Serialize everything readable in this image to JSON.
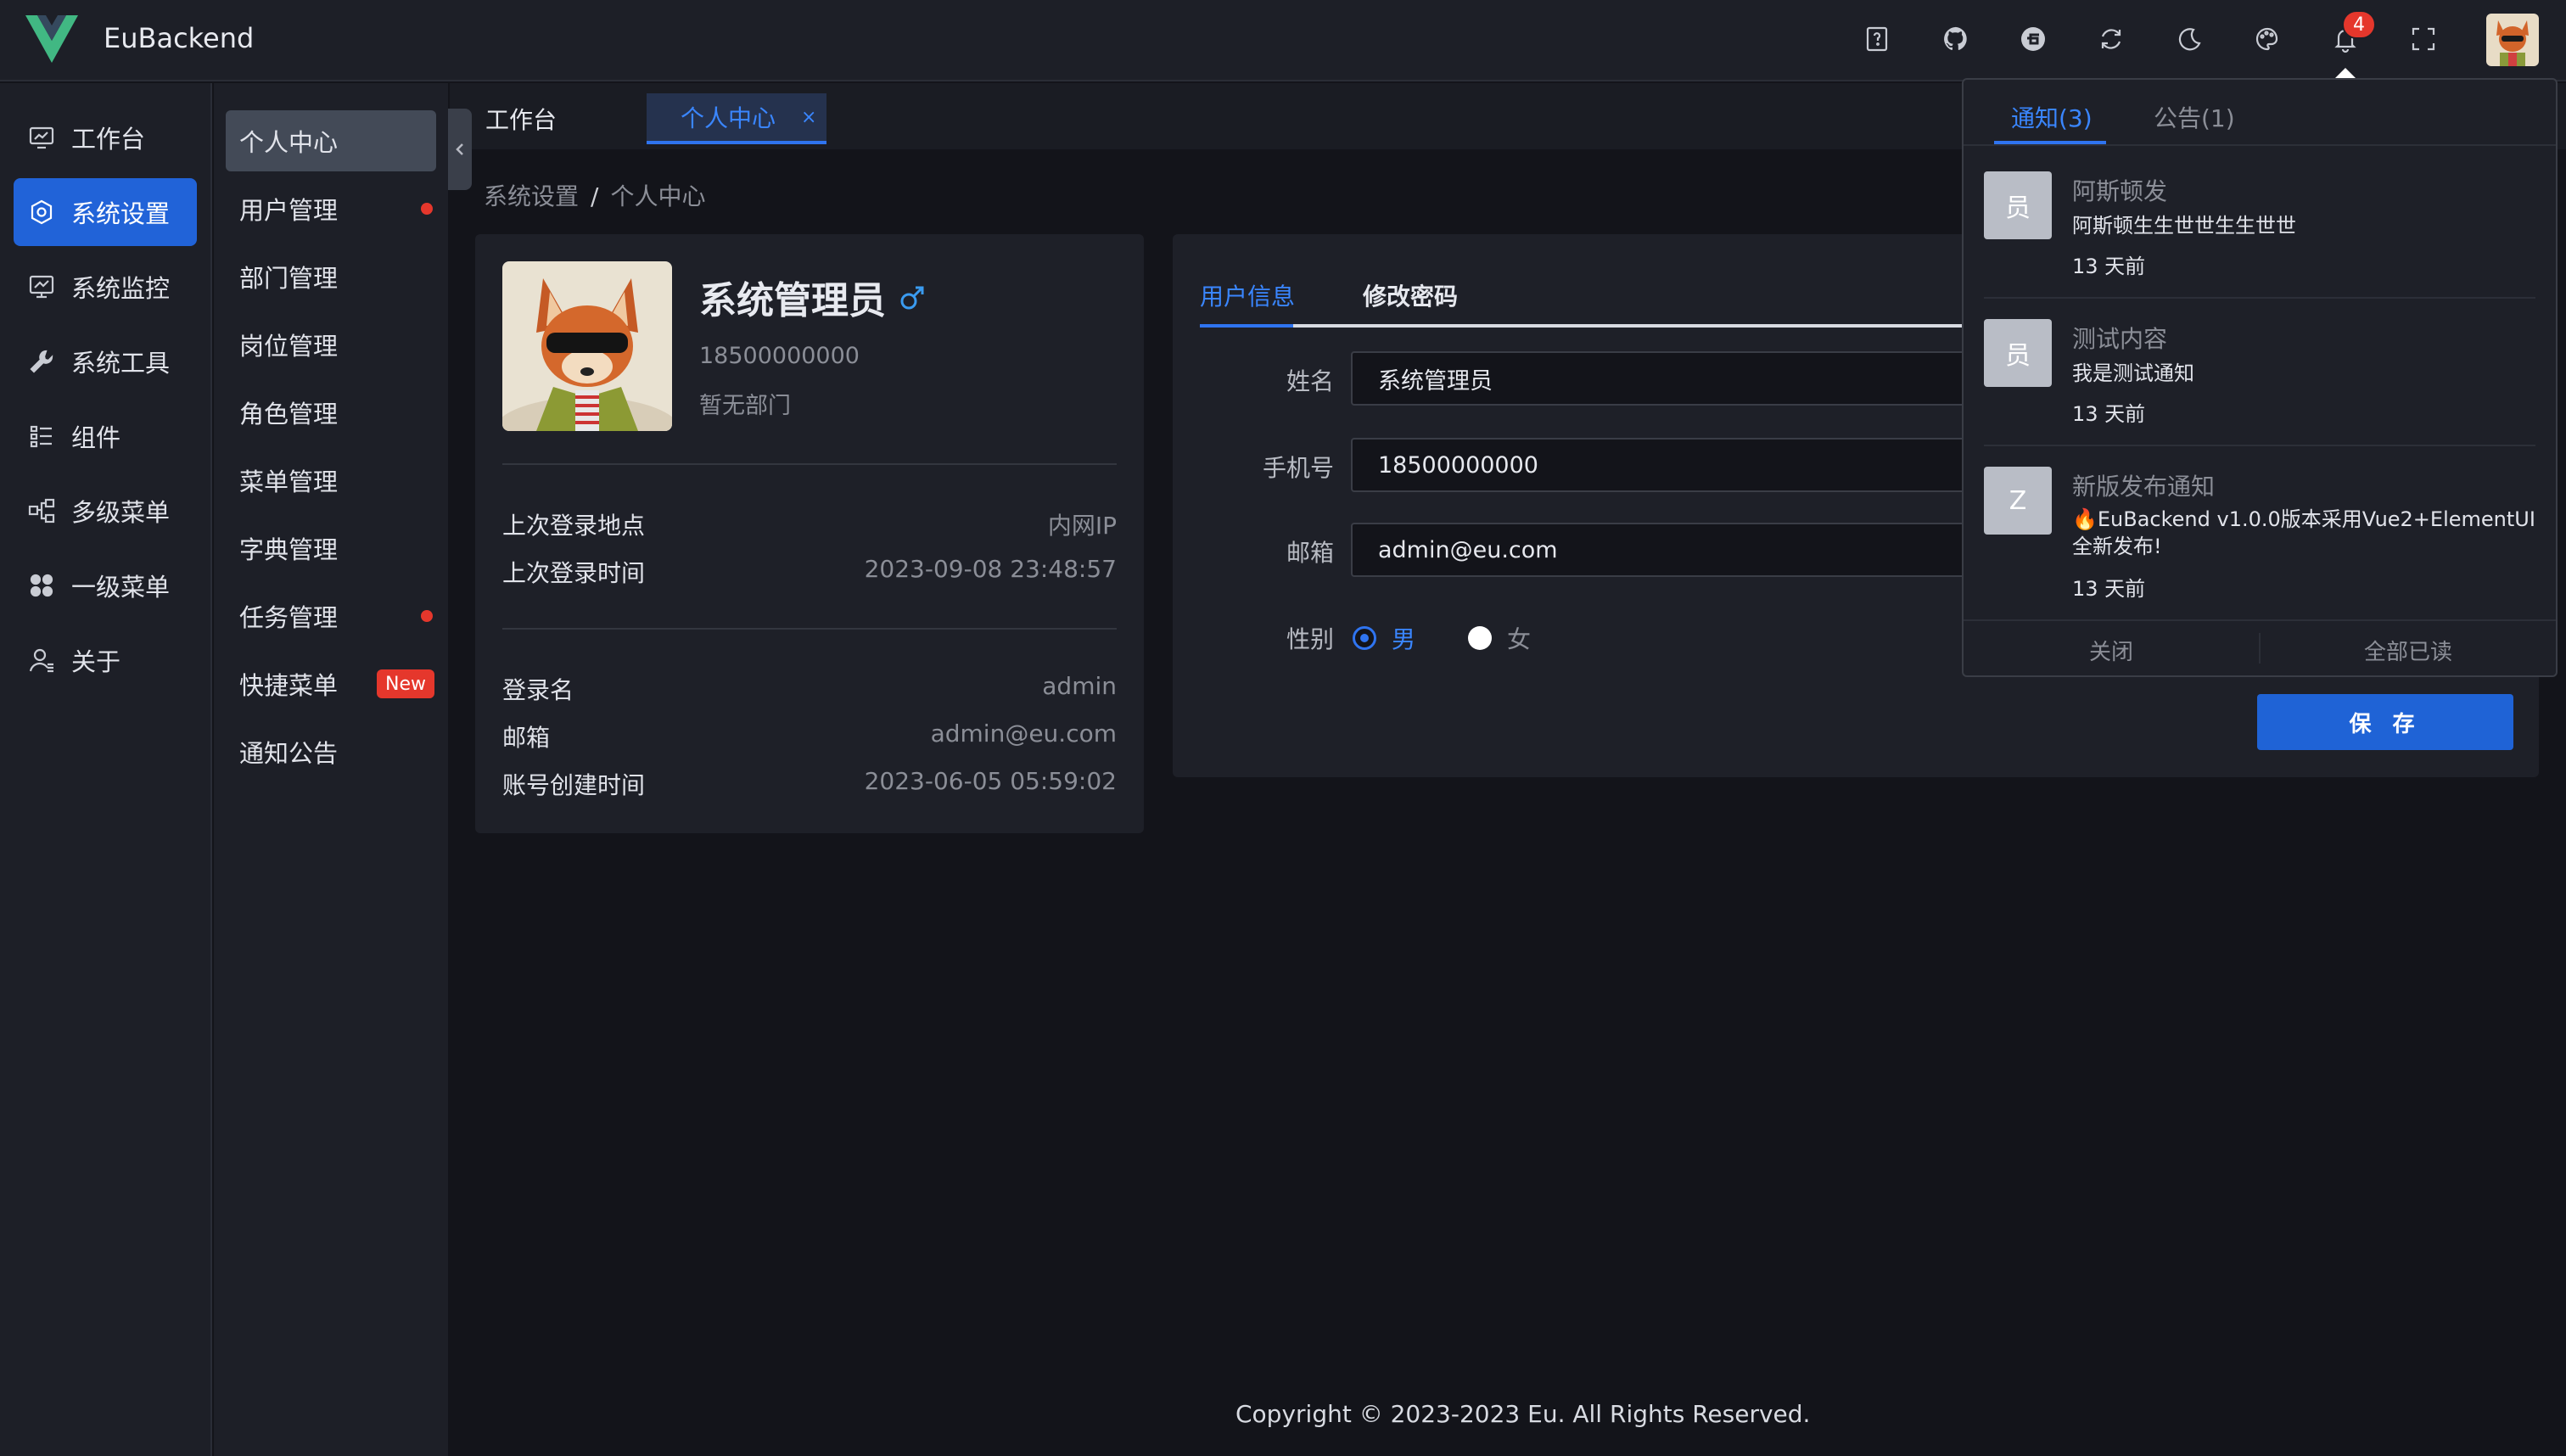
{
  "app": {
    "title": "EuBackend"
  },
  "header": {
    "icons": [
      "help-icon",
      "github-icon",
      "gitee-icon",
      "refresh-icon",
      "moon-icon",
      "palette-icon",
      "bell-icon",
      "fullscreen-icon"
    ],
    "notify_count": "4"
  },
  "sidebar": {
    "items": [
      {
        "label": "工作台",
        "icon": "dashboard-icon"
      },
      {
        "label": "系统设置",
        "icon": "settings-icon",
        "active": true
      },
      {
        "label": "系统监控",
        "icon": "monitor-icon"
      },
      {
        "label": "系统工具",
        "icon": "wrench-icon"
      },
      {
        "label": "组件",
        "icon": "list-icon"
      },
      {
        "label": "多级菜单",
        "icon": "tree-icon"
      },
      {
        "label": "一级菜单",
        "icon": "grid-icon"
      },
      {
        "label": "关于",
        "icon": "user-icon"
      }
    ]
  },
  "submenu": {
    "items": [
      {
        "label": "个人中心"
      },
      {
        "label": "用户管理"
      },
      {
        "label": "部门管理"
      },
      {
        "label": "岗位管理"
      },
      {
        "label": "角色管理"
      },
      {
        "label": "菜单管理"
      },
      {
        "label": "字典管理"
      },
      {
        "label": "任务管理"
      },
      {
        "label": "快捷菜单",
        "badge": "New"
      },
      {
        "label": "通知公告"
      }
    ]
  },
  "tabs": [
    {
      "label": "工作台"
    },
    {
      "label": "个人中心",
      "close": "×"
    }
  ],
  "breadcrumb": [
    "系统设置",
    "/",
    "个人中心"
  ],
  "profile": {
    "name": "系统管理员",
    "phone": "18500000000",
    "dept": "暂无部门",
    "rows": [
      {
        "label": "上次登录地点",
        "value": "内网IP"
      },
      {
        "label": "上次登录时间",
        "value": "2023-09-08 23:48:57"
      },
      {
        "label": "登录名",
        "value": "admin"
      },
      {
        "label": "邮箱",
        "value": "admin@eu.com"
      },
      {
        "label": "账号创建时间",
        "value": "2023-06-05 05:59:02"
      }
    ]
  },
  "form": {
    "tabs": [
      "用户信息",
      "修改密码"
    ],
    "fields": [
      {
        "label": "姓名",
        "value": "系统管理员"
      },
      {
        "label": "手机号",
        "value": "18500000000"
      },
      {
        "label": "邮箱",
        "value": "admin@eu.com"
      }
    ],
    "gender_label": "性别",
    "gender_options": [
      "男",
      "女"
    ],
    "save_label": "保 存"
  },
  "notifications": {
    "tabs": [
      "通知(3)",
      "公告(1)"
    ],
    "items": [
      {
        "avatar": "员",
        "title": "阿斯顿发",
        "body": "阿斯顿生生世世生生世世",
        "time": "13 天前"
      },
      {
        "avatar": "员",
        "title": "测试内容",
        "body": "我是测试通知",
        "time": "13 天前"
      },
      {
        "avatar": "Z",
        "title": "新版发布通知",
        "body": "🔥EuBackend v1.0.0版本采用Vue2+ElementUI全新发布!",
        "time": "13 天前"
      }
    ],
    "close_label": "关闭",
    "read_all_label": "全部已读"
  },
  "footer": {
    "text": "Copyright © 2023-2023 Eu. All Rights Reserved."
  },
  "colors": {
    "accent": "#2f74f0",
    "danger": "#e5372c",
    "logo_green": "#41b883"
  }
}
